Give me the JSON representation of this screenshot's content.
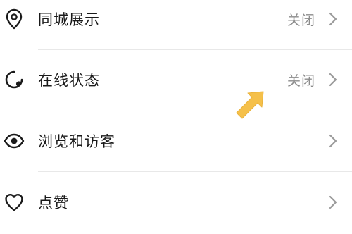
{
  "settings": {
    "items": [
      {
        "label": "同城展示",
        "value": "关闭",
        "icon": "location-pin-icon"
      },
      {
        "label": "在线状态",
        "value": "关闭",
        "icon": "online-status-icon"
      },
      {
        "label": "浏览和访客",
        "value": "",
        "icon": "eye-icon"
      },
      {
        "label": "点赞",
        "value": "",
        "icon": "heart-icon"
      }
    ]
  },
  "colors": {
    "label": "#1a1a1a",
    "value": "#8c8c8c",
    "chevron": "#9a9a9a",
    "divider": "#e8e8e8",
    "annotation_arrow": "#f5c04a"
  }
}
